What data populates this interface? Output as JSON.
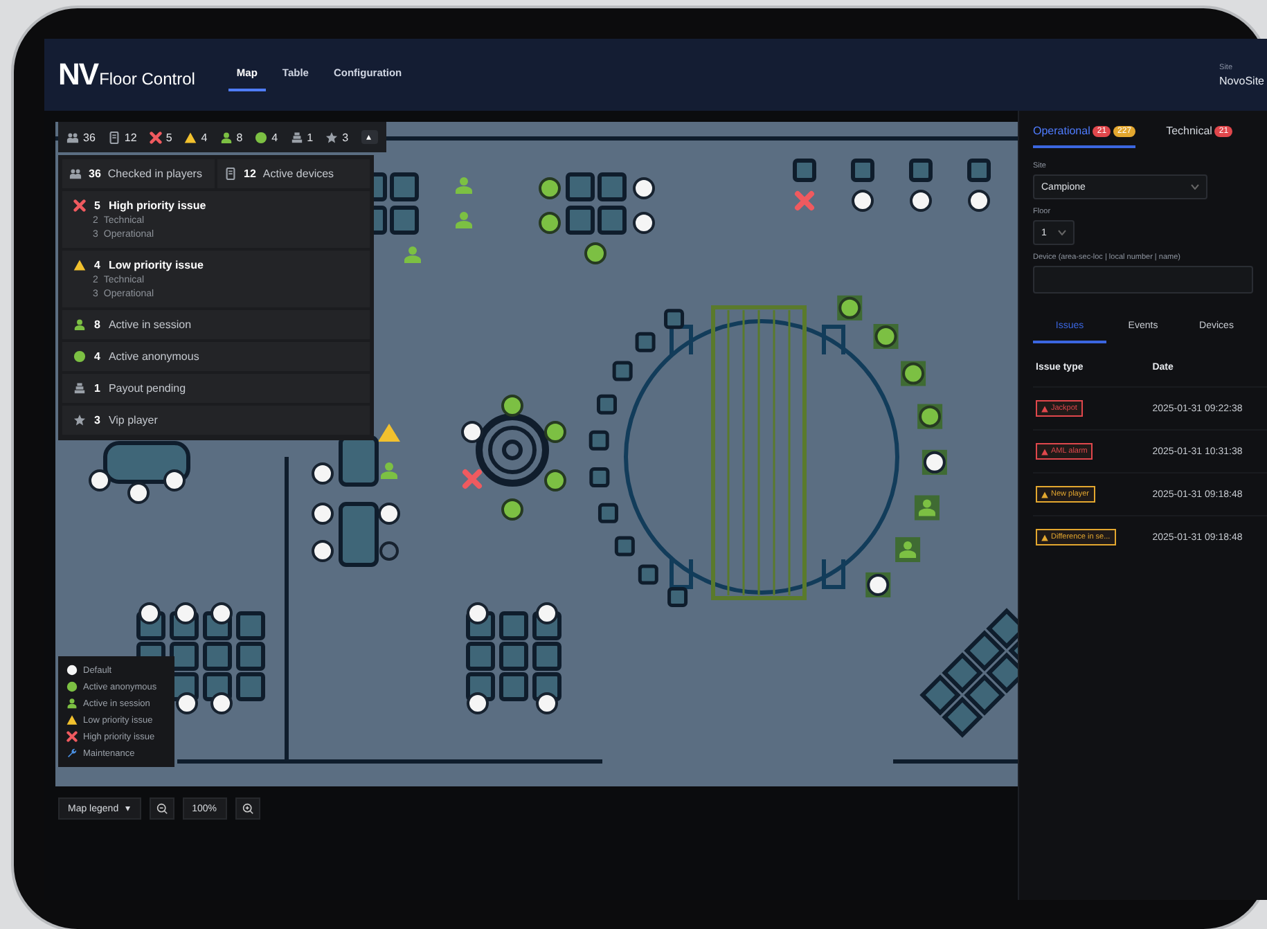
{
  "app": {
    "logo": "NV",
    "title": "Floor Control"
  },
  "nav_tabs": [
    {
      "label": "Map",
      "selected": true
    },
    {
      "label": "Table",
      "selected": false
    },
    {
      "label": "Configuration",
      "selected": false
    }
  ],
  "site": {
    "label": "Site",
    "value": "NovoSite"
  },
  "summary_bar": {
    "items": [
      {
        "kind": "players",
        "count": "36"
      },
      {
        "kind": "devices",
        "count": "12"
      },
      {
        "kind": "high",
        "count": "5"
      },
      {
        "kind": "low",
        "count": "4"
      },
      {
        "kind": "session",
        "count": "8"
      },
      {
        "kind": "anonymous",
        "count": "4"
      },
      {
        "kind": "payout",
        "count": "1"
      },
      {
        "kind": "vip",
        "count": "3"
      }
    ],
    "toggle": "▴"
  },
  "summary_panel": {
    "totals": [
      {
        "kind": "players",
        "count": "36",
        "label": "Checked in players"
      },
      {
        "kind": "devices",
        "count": "12",
        "label": "Active devices"
      }
    ],
    "groups": [
      {
        "kind": "high",
        "count": "5",
        "label": "High priority issue",
        "details": [
          {
            "count": "2",
            "label": "Technical"
          },
          {
            "count": "3",
            "label": "Operational"
          }
        ]
      },
      {
        "kind": "low",
        "count": "4",
        "label": "Low priority issue",
        "details": [
          {
            "count": "2",
            "label": "Technical"
          },
          {
            "count": "3",
            "label": "Operational"
          }
        ]
      },
      {
        "kind": "session",
        "count": "8",
        "label": "Active in session"
      },
      {
        "kind": "anonymous",
        "count": "4",
        "label": "Active anonymous"
      },
      {
        "kind": "payout",
        "count": "1",
        "label": "Payout pending"
      },
      {
        "kind": "vip",
        "count": "3",
        "label": "Vip player"
      }
    ]
  },
  "legend": {
    "items": [
      {
        "kind": "default",
        "label": "Default"
      },
      {
        "kind": "anonymous",
        "label": "Active anonymous"
      },
      {
        "kind": "session",
        "label": "Active in session"
      },
      {
        "kind": "low",
        "label": "Low priority issue"
      },
      {
        "kind": "high",
        "label": "High priority issue"
      },
      {
        "kind": "maintenance",
        "label": "Maintenance"
      }
    ],
    "button": "Map legend",
    "caret": "▾"
  },
  "zoom": {
    "value": "100%"
  },
  "panel": {
    "tabs": [
      {
        "label": "Operational",
        "selected": true,
        "badges": [
          {
            "text": "21",
            "color": "#e0474c"
          },
          {
            "text": "227",
            "color": "#e3a72f"
          }
        ]
      },
      {
        "label": "Technical",
        "selected": false,
        "badges": [
          {
            "text": "21",
            "color": "#e0474c"
          }
        ]
      }
    ],
    "fields": [
      {
        "kind": "select",
        "label": "Site",
        "value": "Campione"
      },
      {
        "kind": "select",
        "label": "Floor",
        "value": "1"
      },
      {
        "kind": "text",
        "label": "Device (area-sec-loc | local number | name)"
      }
    ],
    "subtabs": [
      {
        "label": "Issues",
        "selected": true
      },
      {
        "label": "Events",
        "selected": false
      },
      {
        "label": "Devices",
        "selected": false
      }
    ],
    "table": {
      "columns": [
        "Issue type",
        "Date"
      ],
      "rows": [
        {
          "color": "#e0474c",
          "type": "Jackpot",
          "date": "2025-01-31 09:22:38"
        },
        {
          "color": "#e0474c",
          "type": "AML alarm",
          "date": "2025-01-31 10:31:38"
        },
        {
          "color": "#e3a72f",
          "type": "New player",
          "date": "2025-01-31 09:18:48"
        },
        {
          "color": "#e3a72f",
          "type": "Difference in se...",
          "date": "2025-01-31 09:18:48"
        }
      ]
    }
  }
}
